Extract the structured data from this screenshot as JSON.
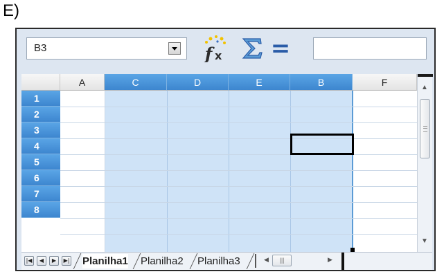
{
  "question_label": "E)",
  "name_box": {
    "value": "B3"
  },
  "toolbar": {
    "function_wizard_icon": "fx-icon",
    "sum_icon": "sigma-icon",
    "formula_icon": "equals-icon",
    "formula_input_value": ""
  },
  "columns": [
    "A",
    "C",
    "D",
    "E",
    "B",
    "F"
  ],
  "rows": [
    "1",
    "2",
    "3",
    "4",
    "5",
    "6",
    "7",
    "8"
  ],
  "active_cell": "B3",
  "sheet_tabs": [
    {
      "label": "Planilha1",
      "active": true
    },
    {
      "label": "Planilha2",
      "active": false
    },
    {
      "label": "Planilha3",
      "active": false
    }
  ],
  "colors": {
    "selection_header": "#3d86cf",
    "selection_fill": "#cfe3f7",
    "toolbar_bg": "#dde6f1"
  }
}
